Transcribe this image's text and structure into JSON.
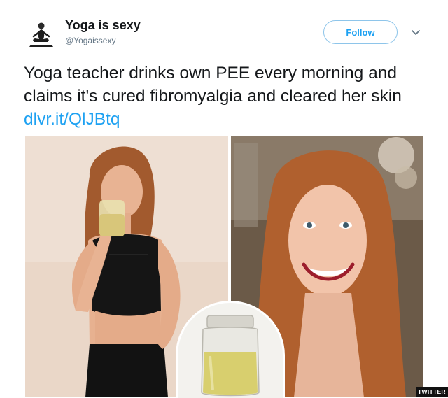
{
  "tweet": {
    "display_name": "Yoga is sexy",
    "handle": "@Yogaissexy",
    "follow_label": "Follow",
    "text": "Yoga teacher drinks own PEE every morning and claims it's cured fibromyalgia and cleared her skin ",
    "link": "dlvr.it/QlJBtq"
  },
  "media": {
    "credit": "TWITTER"
  },
  "colors": {
    "accent": "#1da1f2",
    "text": "#14171a",
    "muted": "#657786"
  },
  "icons": [
    "yoga-avatar-icon",
    "chevron-down-icon"
  ]
}
